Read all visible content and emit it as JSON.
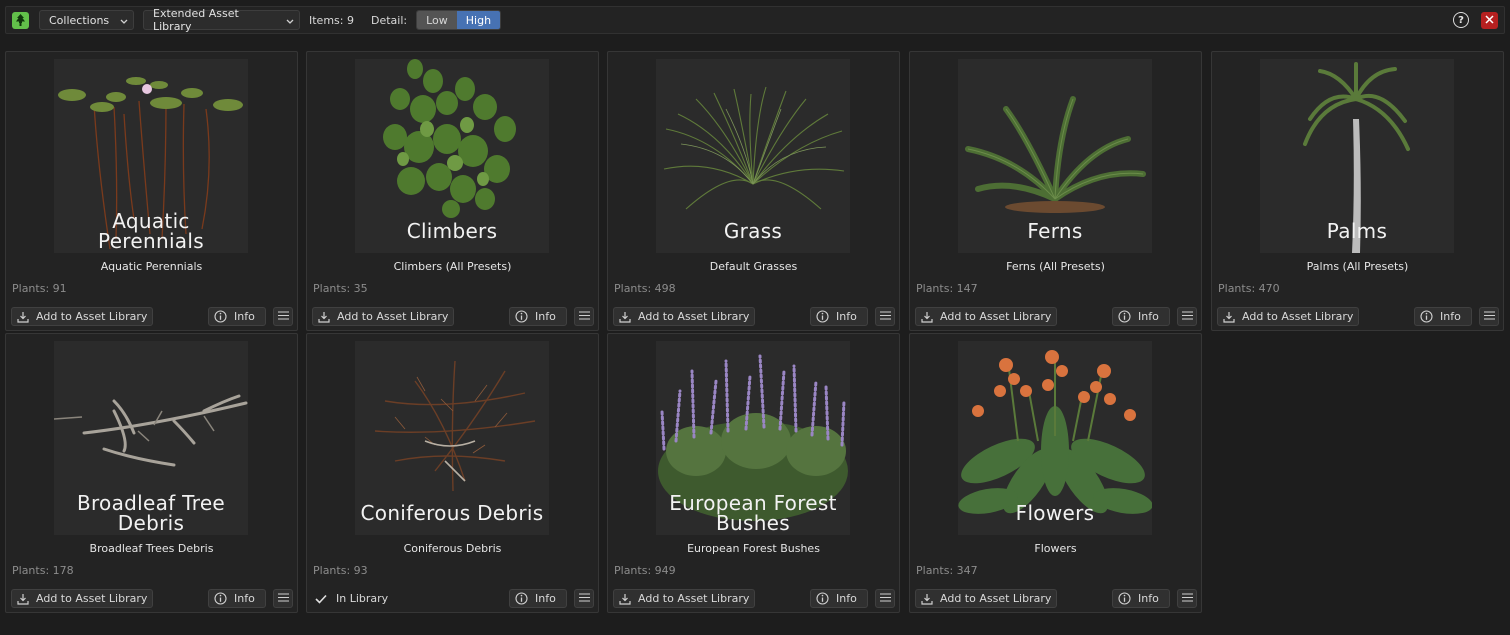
{
  "toolbar": {
    "app_icon": "tree-icon",
    "collections_dropdown": "Collections",
    "library_dropdown": "Extended Asset Library",
    "items_label": "Items: 9",
    "detail_label": "Detail:",
    "detail_options": [
      "Low",
      "High"
    ],
    "detail_selected": "High",
    "help_icon": "help-icon",
    "close_icon": "close-icon"
  },
  "buttons": {
    "add": "Add to Asset Library",
    "info": "Info",
    "in_library": "In Library"
  },
  "cards": [
    {
      "thumb_label": [
        "Aquatic",
        "Perennials"
      ],
      "title": "Aquatic Perennials",
      "plants": "Plants: 91",
      "status": "add"
    },
    {
      "thumb_label": [
        "Climbers"
      ],
      "title": "Climbers (All Presets)",
      "plants": "Plants: 35",
      "status": "add"
    },
    {
      "thumb_label": [
        "Grass"
      ],
      "title": "Default Grasses",
      "plants": "Plants: 498",
      "status": "add"
    },
    {
      "thumb_label": [
        "Ferns"
      ],
      "title": "Ferns (All Presets)",
      "plants": "Plants: 147",
      "status": "add"
    },
    {
      "thumb_label": [
        "Palms"
      ],
      "title": "Palms (All Presets)",
      "plants": "Plants: 470",
      "status": "add"
    },
    {
      "thumb_label": [
        "Broadleaf Tree",
        "Debris"
      ],
      "title": "Broadleaf Trees Debris",
      "plants": "Plants: 178",
      "status": "add"
    },
    {
      "thumb_label": [
        "Coniferous Debris"
      ],
      "title": "Coniferous Debris",
      "plants": "Plants: 93",
      "status": "in_library"
    },
    {
      "thumb_label": [
        "European Forest",
        "Bushes"
      ],
      "title": "European Forest Bushes",
      "plants": "Plants: 949",
      "status": "add"
    },
    {
      "thumb_label": [
        "Flowers"
      ],
      "title": "Flowers",
      "plants": "Plants: 347",
      "status": "add"
    }
  ],
  "colors": {
    "background": "#1d1d1d",
    "card": "#232323",
    "thumb": "#2b2b2b",
    "accent_blue": "#4772b3",
    "app_green": "#62c04a",
    "close_red": "#b62020"
  }
}
